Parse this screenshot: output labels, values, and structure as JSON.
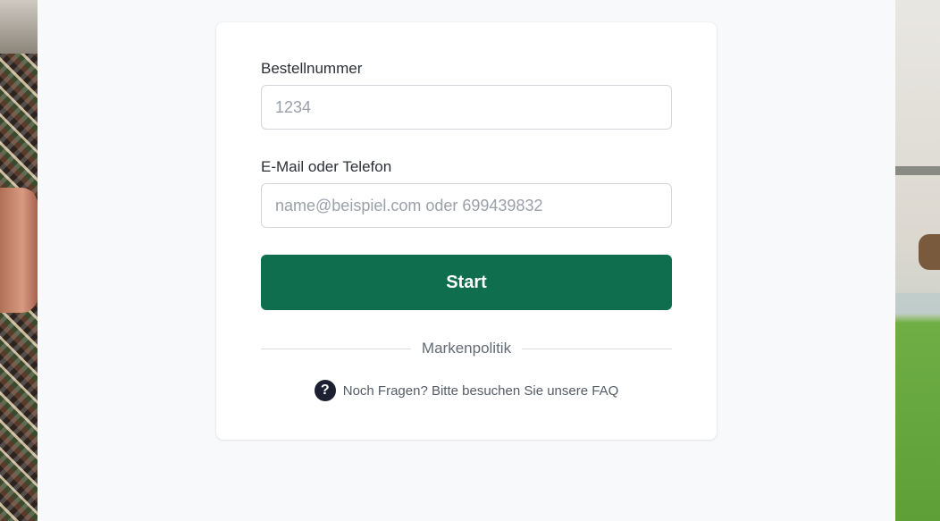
{
  "form": {
    "order_label": "Bestellnummer",
    "order_placeholder": "1234",
    "contact_label": "E-Mail oder Telefon",
    "contact_placeholder": "name@beispiel.com oder 699439832",
    "submit_label": "Start"
  },
  "divider": {
    "label": "Markenpolitik"
  },
  "help": {
    "icon": "question-circle-icon",
    "text": "Noch Fragen? Bitte besuchen Sie unsere FAQ"
  },
  "colors": {
    "primary": "#0e6e4e",
    "background": "#f8f9fb",
    "card": "#ffffff"
  }
}
